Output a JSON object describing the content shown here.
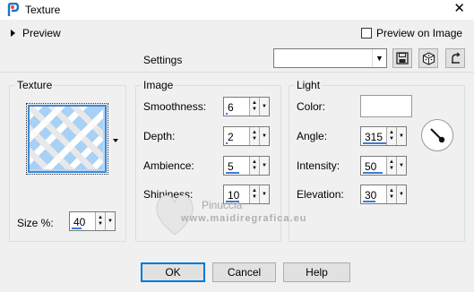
{
  "window": {
    "title": "Texture",
    "close_glyph": "✕"
  },
  "preview": {
    "label": "Preview",
    "preview_on_image_label": "Preview on Image",
    "preview_on_image_checked": false
  },
  "settings": {
    "label": "Settings",
    "selected_value": ""
  },
  "texture_group": {
    "title": "Texture",
    "size_label": "Size %:",
    "size_value": "40",
    "size_level": 0.4
  },
  "image_group": {
    "title": "Image",
    "fields": [
      {
        "label": "Smoothness:",
        "value": "6",
        "level": 0.06
      },
      {
        "label": "Depth:",
        "value": "2",
        "level": 0.05
      },
      {
        "label": "Ambience:",
        "value": "5",
        "level": 0.55
      },
      {
        "label": "Shininess:",
        "value": "10",
        "level": 0.55
      }
    ]
  },
  "light_group": {
    "title": "Light",
    "color_label": "Color:",
    "color_value": "#ffffff",
    "angle_label": "Angle:",
    "angle_value": "315",
    "intensity_label": "Intensity:",
    "intensity_value": "50",
    "elevation_label": "Elevation:",
    "elevation_value": "30"
  },
  "buttons": {
    "ok": "OK",
    "cancel": "Cancel",
    "help": "Help"
  },
  "watermark": {
    "name": "Pinuccia",
    "site": "www.maidiregrafica.eu"
  },
  "icons": [
    "app-icon",
    "close-icon",
    "save-preset-icon",
    "randomize-dice-icon",
    "reset-icon",
    "angle-dial-icon"
  ]
}
